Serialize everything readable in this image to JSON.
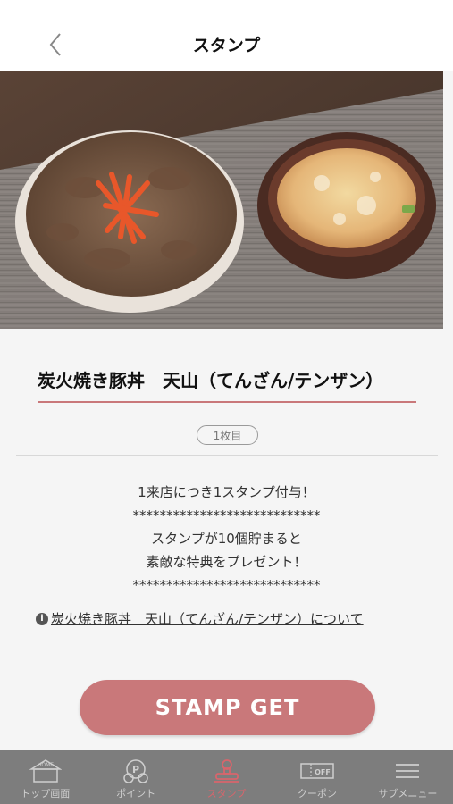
{
  "header": {
    "title": "スタンプ"
  },
  "shop": {
    "name": "炭火焼き豚丼　天山（てんざん/テンザン）"
  },
  "stamp_count": "1枚目",
  "info_lines": [
    "1来店につき1スタンプ付与！",
    "****************************",
    "スタンプが10個貯まると",
    "素敵な特典をプレゼント！",
    "****************************"
  ],
  "about_link": "炭火焼き豚丼　天山（てんざん/テンザン）について",
  "stamp_button": "STAMP GET",
  "tabs": [
    {
      "label": "トップ画面",
      "icon": "home-icon",
      "icon_text": "HOME"
    },
    {
      "label": "ポイント",
      "icon": "point-icon",
      "icon_text": "P"
    },
    {
      "label": "スタンプ",
      "icon": "stamp-icon",
      "icon_text": ""
    },
    {
      "label": "クーポン",
      "icon": "coupon-icon",
      "icon_text": "OFF"
    },
    {
      "label": "サブメニュー",
      "icon": "menu-icon",
      "icon_text": ""
    }
  ],
  "colors": {
    "accent": "#c9787a",
    "tab_active": "#d8656c",
    "tabbar_bg": "#7d7d7d"
  }
}
